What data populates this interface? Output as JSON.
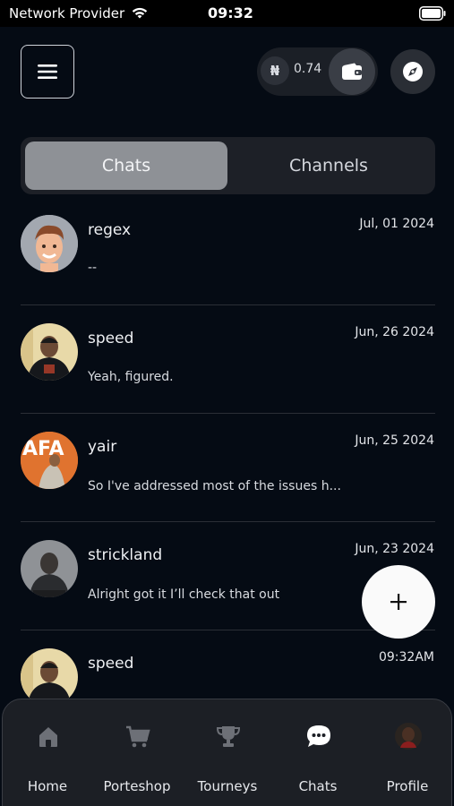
{
  "status_bar": {
    "carrier": "Network Provider",
    "time": "09:32"
  },
  "header": {
    "wallet_currency_symbol": "₦",
    "wallet_balance": "0.74"
  },
  "tabs": [
    {
      "label": "Chats",
      "active": true
    },
    {
      "label": "Channels",
      "active": false
    }
  ],
  "chats": [
    {
      "name": "regex",
      "preview": "--",
      "date": "Jul, 01 2024"
    },
    {
      "name": "speed",
      "preview": "Yeah, figured.",
      "date": "Jun, 26 2024"
    },
    {
      "name": "yair",
      "preview": "So I've addressed most of the issues h...",
      "date": "Jun, 25 2024"
    },
    {
      "name": "strickland",
      "preview": "Alright got it I’ll check that out",
      "date": "Jun, 23 2024"
    },
    {
      "name": "speed",
      "preview": "",
      "date": "09:32AM"
    }
  ],
  "bottom_nav": [
    {
      "label": "Home",
      "icon": "home-icon"
    },
    {
      "label": "Porteshop",
      "icon": "cart-icon"
    },
    {
      "label": "Tourneys",
      "icon": "trophy-icon"
    },
    {
      "label": "Chats",
      "icon": "chat-bubble-icon",
      "active": true
    },
    {
      "label": "Profile",
      "icon": "profile-avatar"
    }
  ],
  "colors": {
    "background": "#050b14",
    "active_tab": "#8e9196",
    "nav_background": "#1c1f25",
    "fab": "#fafafa"
  }
}
